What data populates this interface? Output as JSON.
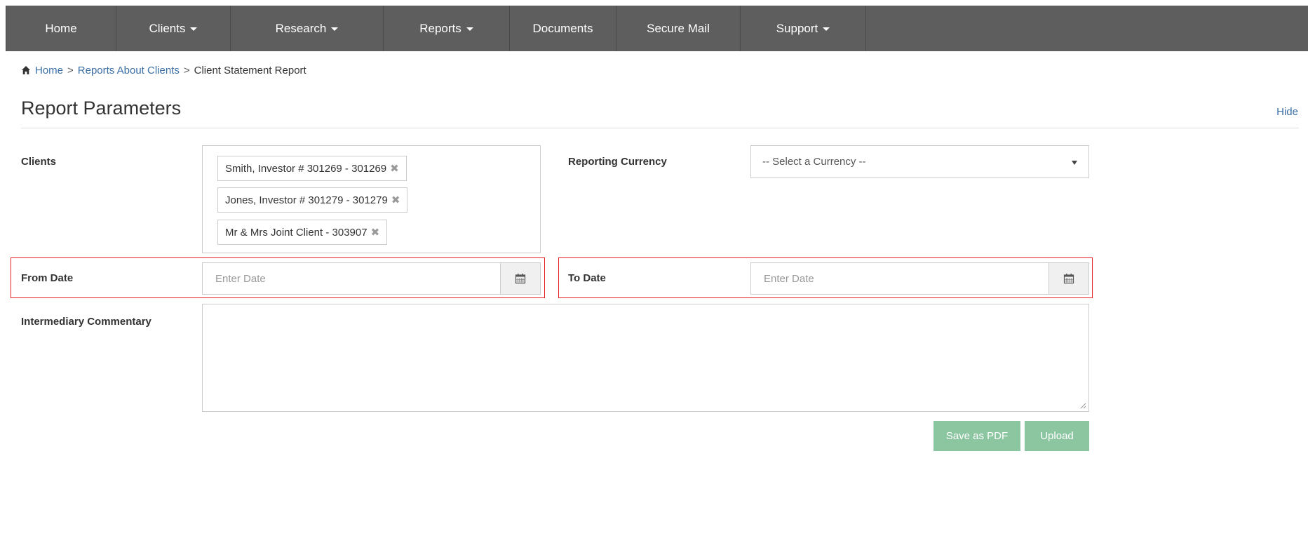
{
  "nav": {
    "items": [
      {
        "label": "Home",
        "dropdown": false
      },
      {
        "label": "Clients",
        "dropdown": true
      },
      {
        "label": "Research",
        "dropdown": true
      },
      {
        "label": "Reports",
        "dropdown": true
      },
      {
        "label": "Documents",
        "dropdown": false
      },
      {
        "label": "Secure Mail",
        "dropdown": false
      },
      {
        "label": "Support",
        "dropdown": true
      }
    ]
  },
  "breadcrumb": {
    "home": "Home",
    "reports": "Reports About Clients",
    "current": "Client Statement Report",
    "separator": ">"
  },
  "section": {
    "title": "Report Parameters",
    "hide_label": "Hide"
  },
  "form": {
    "clients_label": "Clients",
    "clients": [
      "Smith, Investor # 301269 - 301269",
      "Jones, Investor # 301279 - 301279",
      "Mr & Mrs Joint Client - 303907"
    ],
    "remove_glyph": "✖",
    "currency_label": "Reporting Currency",
    "currency_placeholder": "-- Select a Currency --",
    "from_date_label": "From Date",
    "from_date_placeholder": "Enter Date",
    "to_date_label": "To Date",
    "to_date_placeholder": "Enter Date",
    "commentary_label": "Intermediary Commentary",
    "commentary_value": ""
  },
  "buttons": {
    "save_pdf": "Save as PDF",
    "upload": "Upload"
  },
  "colors": {
    "nav_bg": "#5e5e5e",
    "link": "#3a6ea5",
    "highlight": "#e31e24",
    "button_bg": "#8cc6a1"
  }
}
